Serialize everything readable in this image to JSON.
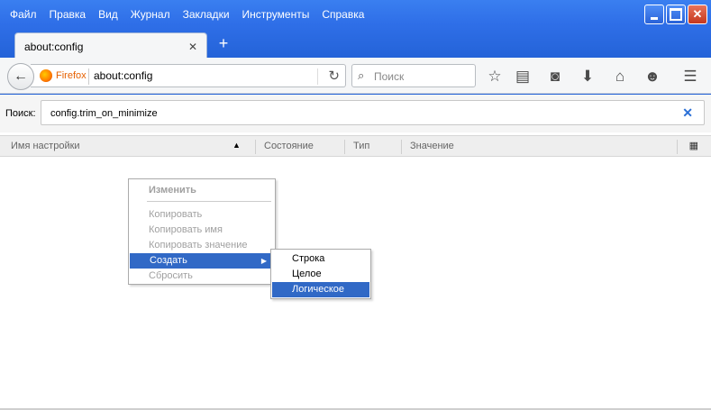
{
  "menubar": {
    "items": [
      "Файл",
      "Правка",
      "Вид",
      "Журнал",
      "Закладки",
      "Инструменты",
      "Справка"
    ]
  },
  "tab": {
    "title": "about:config",
    "close": "✕",
    "new_tab": "+"
  },
  "toolbar": {
    "brand": "Firefox",
    "url": "about:config",
    "search_placeholder": "Поиск",
    "icons": [
      "back-icon",
      "reload-icon",
      "search-icon",
      "bookmark-star-icon",
      "reading-list-icon",
      "pocket-icon",
      "download-icon",
      "home-icon",
      "chat-icon",
      "menu-icon"
    ]
  },
  "filter": {
    "label": "Поиск:",
    "value": "config.trim_on_minimize"
  },
  "columns": [
    "Имя настройки",
    "Состояние",
    "Тип",
    "Значение"
  ],
  "context_menu": {
    "items": [
      "Изменить",
      "Копировать",
      "Копировать имя",
      "Копировать значение",
      "Создать",
      "Сбросить"
    ],
    "active_index": 4
  },
  "submenu": {
    "items": [
      "Строка",
      "Целое",
      "Логическое"
    ],
    "active_index": 2
  },
  "colors": {
    "accent": "#3169c6",
    "titlebar": "#2f6fe8",
    "firefox_brand": "#e66000"
  }
}
